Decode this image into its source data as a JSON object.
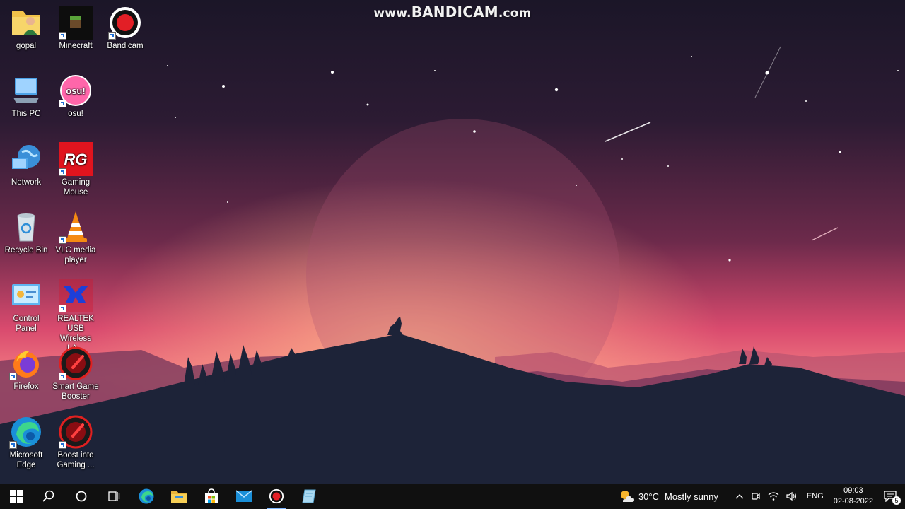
{
  "watermark": {
    "prefix": "www.",
    "brand": "BANDICAM",
    "suffix": ".com"
  },
  "desktop_icons": [
    {
      "id": "gopal",
      "label": "gopal",
      "icon": "user-folder-icon"
    },
    {
      "id": "minecraft",
      "label": "Minecraft",
      "icon": "minecraft-icon"
    },
    {
      "id": "bandicam",
      "label": "Bandicam",
      "icon": "bandicam-record-icon"
    },
    {
      "id": "this-pc",
      "label": "This PC",
      "icon": "computer-icon"
    },
    {
      "id": "osu",
      "label": "osu!",
      "icon": "osu-icon",
      "icon_text": "osu!"
    },
    {
      "id": "network",
      "label": "Network",
      "icon": "network-globe-icon"
    },
    {
      "id": "gaming-mouse",
      "label": "Gaming Mouse",
      "icon": "rg-icon",
      "icon_text": "RG"
    },
    {
      "id": "recycle-bin",
      "label": "Recycle Bin",
      "icon": "recycle-bin-icon"
    },
    {
      "id": "vlc",
      "label": "VLC media player",
      "icon": "vlc-cone-icon"
    },
    {
      "id": "control-panel",
      "label": "Control Panel",
      "icon": "control-panel-icon"
    },
    {
      "id": "realtek",
      "label": "REALTEK USB Wireless LA...",
      "icon": "realtek-icon"
    },
    {
      "id": "firefox",
      "label": "Firefox",
      "icon": "firefox-icon"
    },
    {
      "id": "smart-game-booster",
      "label": "Smart Game Booster",
      "icon": "game-booster-icon"
    },
    {
      "id": "edge",
      "label": "Microsoft Edge",
      "icon": "edge-icon"
    },
    {
      "id": "boost-gaming",
      "label": "Boost into Gaming ...",
      "icon": "game-booster-icon"
    }
  ],
  "taskbar": {
    "buttons": [
      {
        "id": "start",
        "icon": "windows-start-icon"
      },
      {
        "id": "search",
        "icon": "search-icon"
      },
      {
        "id": "cortana",
        "icon": "cortana-circle-icon"
      },
      {
        "id": "task-view",
        "icon": "task-view-icon"
      },
      {
        "id": "edge",
        "icon": "edge-icon"
      },
      {
        "id": "file-explorer",
        "icon": "folder-icon"
      },
      {
        "id": "store",
        "icon": "store-bag-icon"
      },
      {
        "id": "mail",
        "icon": "mail-icon"
      },
      {
        "id": "bandicam",
        "icon": "bandicam-record-icon"
      },
      {
        "id": "notepad",
        "icon": "notepad-icon"
      }
    ],
    "tray": {
      "weather": {
        "temp": "30°C",
        "desc": "Mostly sunny",
        "icon": "partly-sunny-icon"
      },
      "lang": "ENG",
      "time": "09:03",
      "date": "02-08-2022",
      "notifications": "5"
    }
  },
  "colors": {
    "taskbar_bg": "#101010",
    "accent": "#7fb6ff",
    "sky_top": "#1b1628",
    "sky_horizon": "#e85a7a"
  }
}
